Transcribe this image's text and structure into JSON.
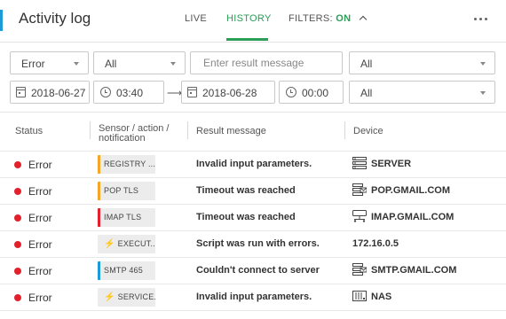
{
  "header": {
    "title": "Activity log",
    "tabs": [
      {
        "label": "LIVE",
        "active": false
      },
      {
        "label": "HISTORY",
        "active": true
      }
    ],
    "filters_label": "FILTERS:",
    "filters_state": "ON",
    "more_icon": "more-horizontal-icon"
  },
  "filters": {
    "status": "Error",
    "type": "All",
    "message_placeholder": "Enter result message",
    "device": "All",
    "from_date": "2018-06-27",
    "from_time": "03:40",
    "arrow": "⟶",
    "to_date": "2018-06-28",
    "to_time": "00:00",
    "extra": "All"
  },
  "table": {
    "columns": {
      "status": "Status",
      "sensor": "Sensor / action / notification",
      "message": "Result message",
      "device": "Device"
    },
    "rows": [
      {
        "status": "Error",
        "sensor": "REGISTRY ...",
        "sensor_color": "#f5a623",
        "bolt": false,
        "message": "Invalid input parameters.",
        "device": "SERVER",
        "device_icon": "server-icon"
      },
      {
        "status": "Error",
        "sensor": "POP TLS",
        "sensor_color": "#f5a623",
        "bolt": false,
        "message": "Timeout was reached",
        "device": "POP.GMAIL.COM",
        "device_icon": "mail-server-icon"
      },
      {
        "status": "Error",
        "sensor": "IMAP TLS",
        "sensor_color": "#e2212c",
        "bolt": false,
        "message": "Timeout was reached",
        "device": "IMAP.GMAIL.COM",
        "device_icon": "network-device-icon"
      },
      {
        "status": "Error",
        "sensor": "EXECUT...",
        "sensor_color": "",
        "bolt": true,
        "message": "Script was run with errors.",
        "device": "172.16.0.5",
        "device_icon": ""
      },
      {
        "status": "Error",
        "sensor": "SMTP 465",
        "sensor_color": "#1d9bd8",
        "bolt": false,
        "message": "Couldn't connect to server",
        "device": "SMTP.GMAIL.COM",
        "device_icon": "mail-server-icon"
      },
      {
        "status": "Error",
        "sensor": "SERVICE...",
        "sensor_color": "",
        "bolt": true,
        "message": "Invalid input parameters.",
        "device": "NAS",
        "device_icon": "nas-icon"
      }
    ]
  },
  "colors": {
    "accent_green": "#2a9d56",
    "accent_blue": "#1d9bd8",
    "error_red": "#e2212c"
  }
}
